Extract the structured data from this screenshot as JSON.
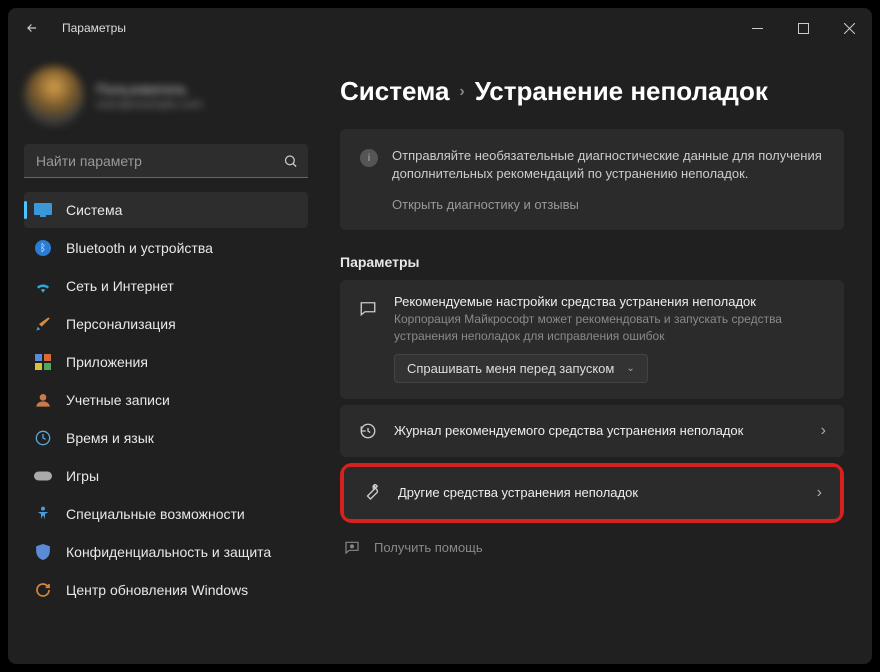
{
  "window": {
    "title": "Параметры"
  },
  "profile": {
    "name": "Пользователь",
    "email": "user@example.com"
  },
  "search": {
    "placeholder": "Найти параметр"
  },
  "nav": {
    "items": [
      {
        "label": "Система"
      },
      {
        "label": "Bluetooth и устройства"
      },
      {
        "label": "Сеть и Интернет"
      },
      {
        "label": "Персонализация"
      },
      {
        "label": "Приложения"
      },
      {
        "label": "Учетные записи"
      },
      {
        "label": "Время и язык"
      },
      {
        "label": "Игры"
      },
      {
        "label": "Специальные возможности"
      },
      {
        "label": "Конфиденциальность и защита"
      },
      {
        "label": "Центр обновления Windows"
      }
    ]
  },
  "breadcrumb": {
    "parent": "Система",
    "leaf": "Устранение неполадок"
  },
  "infocard": {
    "text": "Отправляйте необязательные диагностические данные для получения дополнительных рекомендаций по устранению неполадок.",
    "link": "Открыть диагностику и отзывы"
  },
  "params": {
    "section_label": "Параметры",
    "recommended": {
      "title": "Рекомендуемые настройки средства устранения неполадок",
      "subtitle": "Корпорация Майкрософт может рекомендовать и запускать средства устранения неполадок для исправления ошибок",
      "dropdown": "Спрашивать меня перед запуском"
    },
    "history": {
      "title": "Журнал рекомендуемого средства устранения неполадок"
    },
    "other": {
      "title": "Другие средства устранения неполадок"
    }
  },
  "help": {
    "label": "Получить помощь"
  }
}
